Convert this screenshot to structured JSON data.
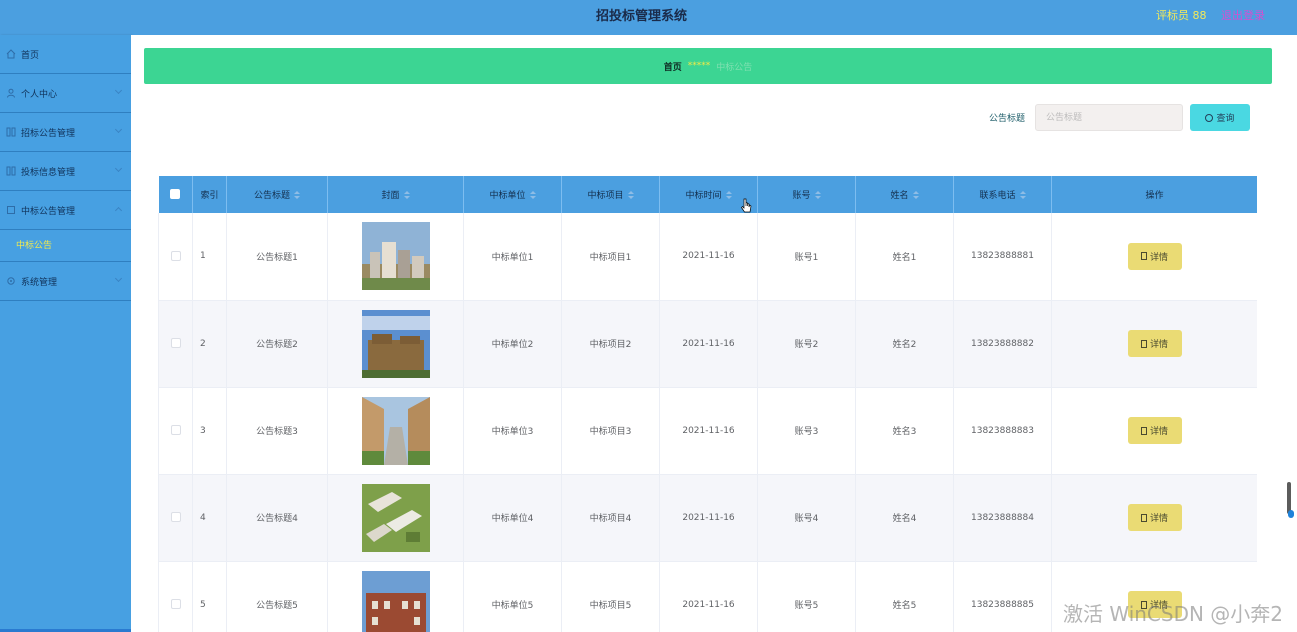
{
  "header": {
    "title": "招投标管理系统",
    "user": "评标员 88",
    "logout": "退出登录"
  },
  "sidebar": {
    "items": [
      {
        "label": "首页",
        "icon": "home-icon"
      },
      {
        "label": "个人中心",
        "icon": "user-icon"
      },
      {
        "label": "招标公告管理",
        "icon": "grid-icon"
      },
      {
        "label": "投标信息管理",
        "icon": "grid-icon"
      },
      {
        "label": "中标公告管理",
        "icon": "square-icon"
      }
    ],
    "active_sub": "中标公告",
    "last_item": {
      "label": "系统管理",
      "icon": "settings-icon"
    }
  },
  "breadcrumb": {
    "home": "首页",
    "separator": "*****",
    "current": "中标公告"
  },
  "search": {
    "label": "公告标题",
    "placeholder": "公告标题",
    "button": "查询"
  },
  "table": {
    "columns": [
      "索引",
      "公告标题",
      "封面",
      "中标单位",
      "中标项目",
      "中标时间",
      "账号",
      "姓名",
      "联系电话",
      "操作"
    ],
    "rows": [
      {
        "index": "1",
        "title": "公告标题1",
        "unit": "中标单位1",
        "project": "中标项目1",
        "time": "2021-11-16",
        "account": "账号1",
        "name": "姓名1",
        "phone": "13823888881",
        "action": "详情"
      },
      {
        "index": "2",
        "title": "公告标题2",
        "unit": "中标单位2",
        "project": "中标项目2",
        "time": "2021-11-16",
        "account": "账号2",
        "name": "姓名2",
        "phone": "13823888882",
        "action": "详情"
      },
      {
        "index": "3",
        "title": "公告标题3",
        "unit": "中标单位3",
        "project": "中标项目3",
        "time": "2021-11-16",
        "account": "账号3",
        "name": "姓名3",
        "phone": "13823888883",
        "action": "详情"
      },
      {
        "index": "4",
        "title": "公告标题4",
        "unit": "中标单位4",
        "project": "中标项目4",
        "time": "2021-11-16",
        "account": "账号4",
        "name": "姓名4",
        "phone": "13823888884",
        "action": "详情"
      },
      {
        "index": "5",
        "title": "公告标题5",
        "unit": "中标单位5",
        "project": "中标项目5",
        "time": "2021-11-16",
        "account": "账号5",
        "name": "姓名5",
        "phone": "13823888885",
        "action": "详情"
      }
    ]
  },
  "watermark": "激活 WinCSDN @小奔2"
}
